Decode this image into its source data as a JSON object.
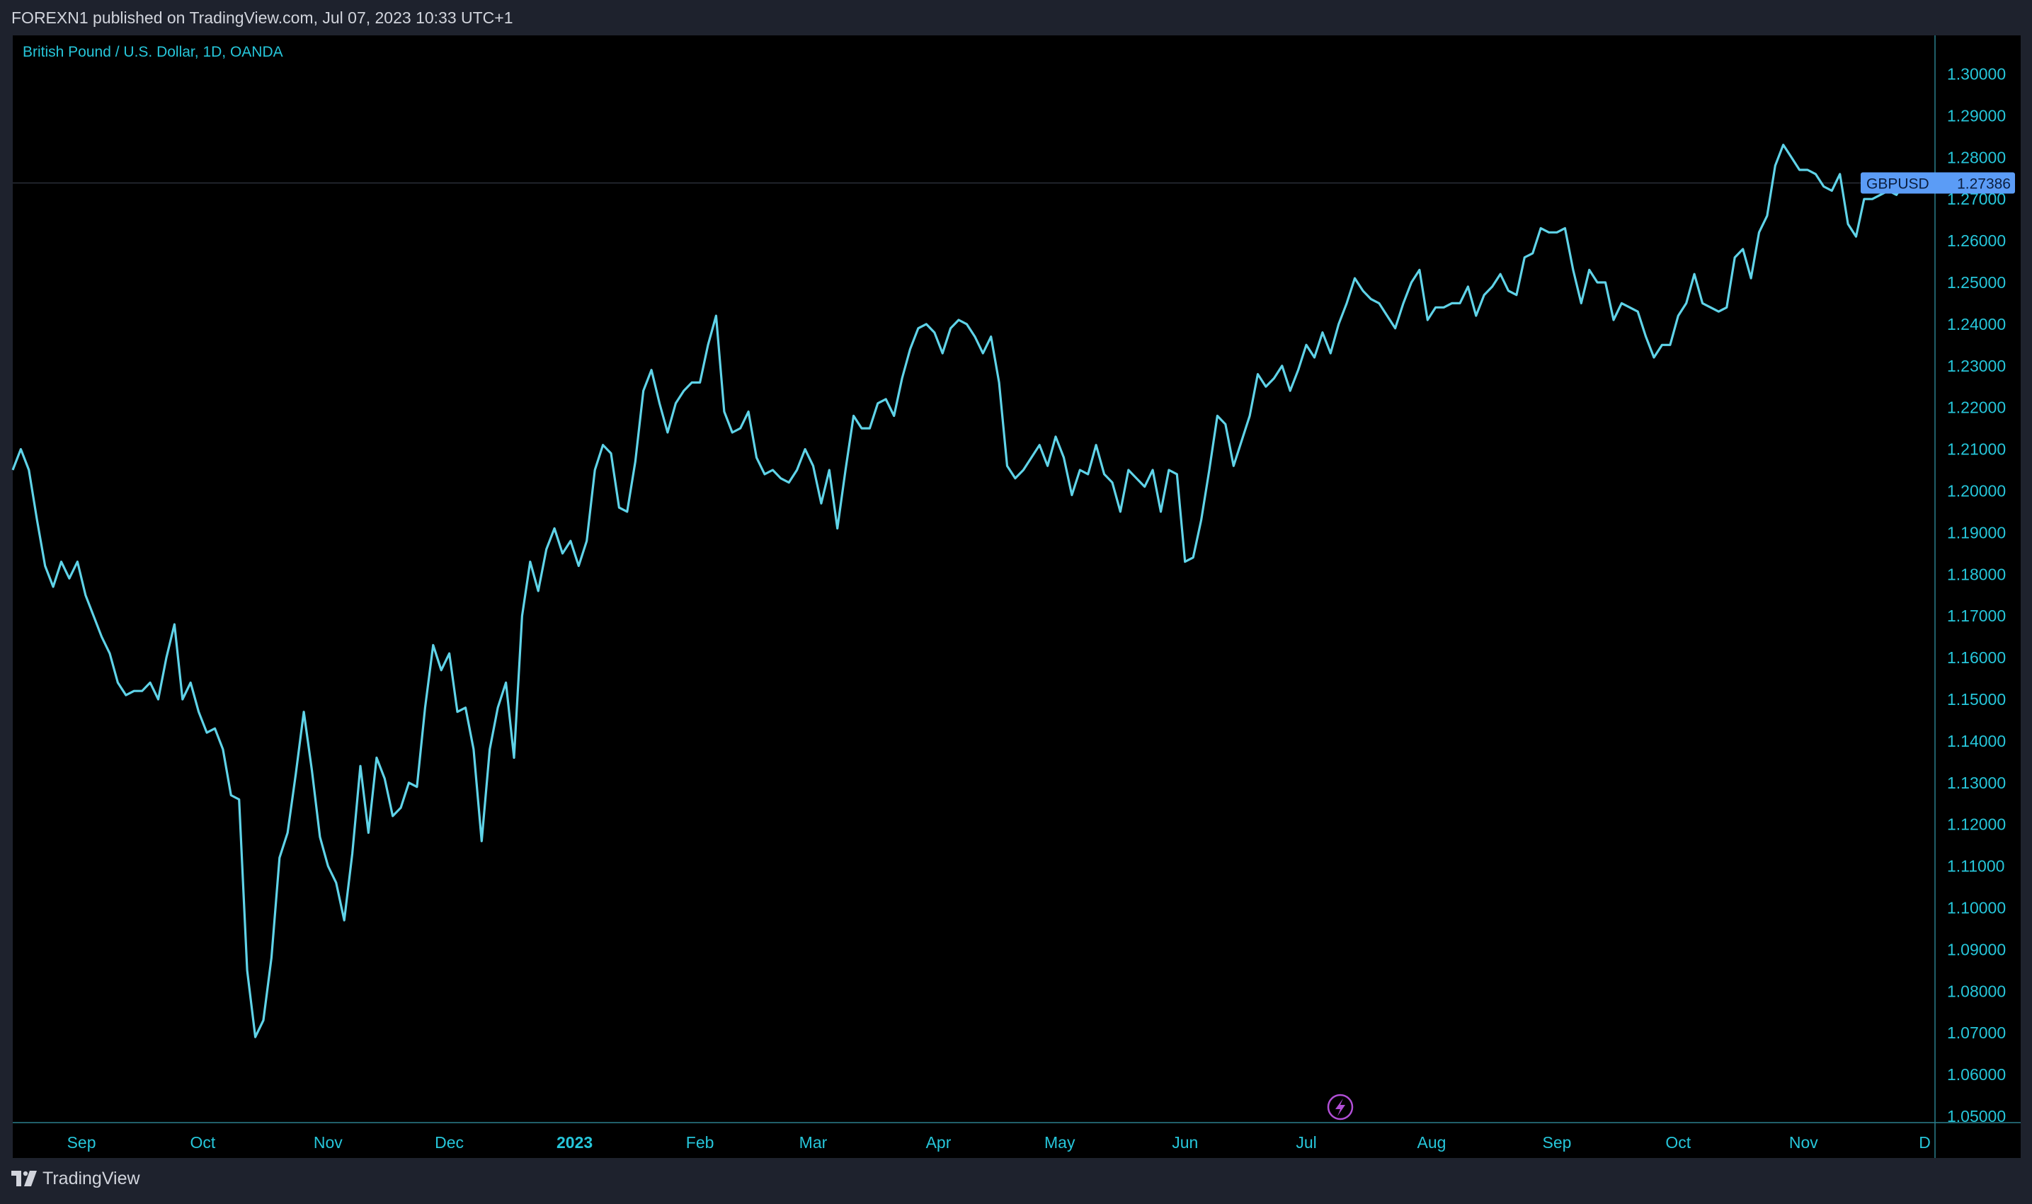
{
  "publisher": "FOREXN1 published on TradingView.com, Jul 07, 2023 10:33 UTC+1",
  "symbol_title": "British Pound / U.S. Dollar, 1D, OANDA",
  "brand": "TradingView",
  "price_badge": {
    "ticker": "GBPUSD",
    "price": "1.27386"
  },
  "colors": {
    "line": "#5fd3e8",
    "axis_text": "#26c6da",
    "badge_bg": "#5b9cf6",
    "background": "#000000"
  },
  "icons": {
    "flash": "flash-icon",
    "logo": "tradingview-logo-icon"
  },
  "chart_data": {
    "type": "line",
    "title": "British Pound / U.S. Dollar, 1D, OANDA",
    "xlabel": "",
    "ylabel": "",
    "ylim": [
      1.05,
      1.3
    ],
    "y_ticks": [
      "1.30000",
      "1.29000",
      "1.28000",
      "1.27000",
      "1.26000",
      "1.25000",
      "1.24000",
      "1.23000",
      "1.22000",
      "1.21000",
      "1.20000",
      "1.19000",
      "1.18000",
      "1.17000",
      "1.16000",
      "1.15000",
      "1.14000",
      "1.13000",
      "1.12000",
      "1.11000",
      "1.10000",
      "1.09000",
      "1.08000",
      "1.07000",
      "1.06000",
      "1.05000"
    ],
    "x_ticks": [
      {
        "label": "Sep",
        "day": 12
      },
      {
        "label": "Oct",
        "day": 42
      },
      {
        "label": "Nov",
        "day": 73
      },
      {
        "label": "Dec",
        "day": 103
      },
      {
        "label": "2023",
        "day": 134,
        "bold": true
      },
      {
        "label": "Feb",
        "day": 165
      },
      {
        "label": "Mar",
        "day": 193
      },
      {
        "label": "Apr",
        "day": 224
      },
      {
        "label": "May",
        "day": 254
      },
      {
        "label": "Jun",
        "day": 285
      },
      {
        "label": "Jul",
        "day": 315
      },
      {
        "label": "Aug",
        "day": 346
      },
      {
        "label": "Sep",
        "day": 377
      },
      {
        "label": "Oct",
        "day": 407
      },
      {
        "label": "Nov",
        "day": 438
      },
      {
        "label": "D",
        "day": 468
      }
    ],
    "x_range_days": [
      -5,
      470
    ],
    "series": [
      {
        "values": [
          [
            -5,
            1.205
          ],
          [
            -3,
            1.21
          ],
          [
            -1,
            1.205
          ],
          [
            1,
            1.193
          ],
          [
            3,
            1.182
          ],
          [
            5,
            1.177
          ],
          [
            7,
            1.183
          ],
          [
            9,
            1.179
          ],
          [
            11,
            1.183
          ],
          [
            13,
            1.175
          ],
          [
            15,
            1.17
          ],
          [
            17,
            1.165
          ],
          [
            19,
            1.161
          ],
          [
            21,
            1.154
          ],
          [
            23,
            1.151
          ],
          [
            25,
            1.152
          ],
          [
            27,
            1.152
          ],
          [
            29,
            1.154
          ],
          [
            31,
            1.15
          ],
          [
            33,
            1.16
          ],
          [
            35,
            1.168
          ],
          [
            37,
            1.15
          ],
          [
            39,
            1.154
          ],
          [
            41,
            1.147
          ],
          [
            43,
            1.142
          ],
          [
            45,
            1.143
          ],
          [
            47,
            1.138
          ],
          [
            49,
            1.127
          ],
          [
            51,
            1.126
          ],
          [
            53,
            1.085
          ],
          [
            55,
            1.069
          ],
          [
            57,
            1.073
          ],
          [
            59,
            1.088
          ],
          [
            61,
            1.112
          ],
          [
            63,
            1.118
          ],
          [
            65,
            1.132
          ],
          [
            67,
            1.147
          ],
          [
            69,
            1.133
          ],
          [
            71,
            1.117
          ],
          [
            73,
            1.11
          ],
          [
            75,
            1.106
          ],
          [
            77,
            1.097
          ],
          [
            79,
            1.113
          ],
          [
            81,
            1.134
          ],
          [
            83,
            1.118
          ],
          [
            85,
            1.136
          ],
          [
            87,
            1.131
          ],
          [
            89,
            1.122
          ],
          [
            91,
            1.124
          ],
          [
            93,
            1.13
          ],
          [
            95,
            1.129
          ],
          [
            97,
            1.148
          ],
          [
            99,
            1.163
          ],
          [
            101,
            1.157
          ],
          [
            103,
            1.161
          ],
          [
            105,
            1.147
          ],
          [
            107,
            1.148
          ],
          [
            109,
            1.138
          ],
          [
            111,
            1.116
          ],
          [
            113,
            1.138
          ],
          [
            115,
            1.148
          ],
          [
            117,
            1.154
          ],
          [
            119,
            1.136
          ],
          [
            121,
            1.17
          ],
          [
            123,
            1.183
          ],
          [
            125,
            1.176
          ],
          [
            127,
            1.186
          ],
          [
            129,
            1.191
          ],
          [
            131,
            1.185
          ],
          [
            133,
            1.188
          ],
          [
            135,
            1.182
          ],
          [
            137,
            1.188
          ],
          [
            139,
            1.205
          ],
          [
            141,
            1.211
          ],
          [
            143,
            1.209
          ],
          [
            145,
            1.196
          ],
          [
            147,
            1.195
          ],
          [
            149,
            1.207
          ],
          [
            151,
            1.224
          ],
          [
            153,
            1.229
          ],
          [
            155,
            1.221
          ],
          [
            157,
            1.214
          ],
          [
            159,
            1.221
          ],
          [
            161,
            1.224
          ],
          [
            163,
            1.226
          ],
          [
            165,
            1.226
          ],
          [
            167,
            1.235
          ],
          [
            169,
            1.242
          ],
          [
            171,
            1.219
          ],
          [
            173,
            1.214
          ],
          [
            175,
            1.215
          ],
          [
            177,
            1.219
          ],
          [
            179,
            1.208
          ],
          [
            181,
            1.204
          ],
          [
            183,
            1.205
          ],
          [
            185,
            1.203
          ],
          [
            187,
            1.202
          ],
          [
            189,
            1.205
          ],
          [
            191,
            1.21
          ],
          [
            193,
            1.206
          ],
          [
            195,
            1.197
          ],
          [
            197,
            1.205
          ],
          [
            199,
            1.191
          ],
          [
            201,
            1.205
          ],
          [
            203,
            1.218
          ],
          [
            205,
            1.215
          ],
          [
            207,
            1.215
          ],
          [
            209,
            1.221
          ],
          [
            211,
            1.222
          ],
          [
            213,
            1.218
          ],
          [
            215,
            1.227
          ],
          [
            217,
            1.234
          ],
          [
            219,
            1.239
          ],
          [
            221,
            1.24
          ],
          [
            223,
            1.238
          ],
          [
            225,
            1.233
          ],
          [
            227,
            1.239
          ],
          [
            229,
            1.241
          ],
          [
            231,
            1.24
          ],
          [
            233,
            1.237
          ],
          [
            235,
            1.233
          ],
          [
            237,
            1.237
          ],
          [
            239,
            1.226
          ],
          [
            241,
            1.206
          ],
          [
            243,
            1.203
          ],
          [
            245,
            1.205
          ],
          [
            247,
            1.208
          ],
          [
            249,
            1.211
          ],
          [
            251,
            1.206
          ],
          [
            253,
            1.213
          ],
          [
            255,
            1.208
          ],
          [
            257,
            1.199
          ],
          [
            259,
            1.205
          ],
          [
            261,
            1.204
          ],
          [
            263,
            1.211
          ],
          [
            265,
            1.204
          ],
          [
            267,
            1.202
          ],
          [
            269,
            1.195
          ],
          [
            271,
            1.205
          ],
          [
            273,
            1.203
          ],
          [
            275,
            1.201
          ],
          [
            277,
            1.205
          ],
          [
            279,
            1.195
          ],
          [
            281,
            1.205
          ],
          [
            283,
            1.204
          ],
          [
            285,
            1.183
          ],
          [
            287,
            1.184
          ],
          [
            289,
            1.193
          ],
          [
            291,
            1.205
          ],
          [
            293,
            1.218
          ],
          [
            295,
            1.216
          ],
          [
            297,
            1.206
          ],
          [
            299,
            1.212
          ],
          [
            301,
            1.218
          ],
          [
            303,
            1.228
          ],
          [
            305,
            1.225
          ],
          [
            307,
            1.227
          ],
          [
            309,
            1.23
          ],
          [
            311,
            1.224
          ],
          [
            313,
            1.229
          ],
          [
            315,
            1.235
          ],
          [
            317,
            1.232
          ],
          [
            319,
            1.238
          ],
          [
            321,
            1.233
          ],
          [
            323,
            1.24
          ],
          [
            325,
            1.245
          ],
          [
            327,
            1.251
          ],
          [
            329,
            1.248
          ],
          [
            331,
            1.246
          ],
          [
            333,
            1.245
          ],
          [
            335,
            1.242
          ],
          [
            337,
            1.239
          ],
          [
            339,
            1.245
          ],
          [
            341,
            1.25
          ],
          [
            343,
            1.253
          ],
          [
            345,
            1.241
          ],
          [
            347,
            1.244
          ],
          [
            349,
            1.244
          ],
          [
            351,
            1.245
          ],
          [
            353,
            1.245
          ],
          [
            355,
            1.249
          ],
          [
            357,
            1.242
          ],
          [
            359,
            1.247
          ],
          [
            361,
            1.249
          ],
          [
            363,
            1.252
          ],
          [
            365,
            1.248
          ],
          [
            367,
            1.247
          ],
          [
            369,
            1.256
          ],
          [
            371,
            1.257
          ],
          [
            373,
            1.263
          ],
          [
            375,
            1.262
          ],
          [
            377,
            1.262
          ],
          [
            379,
            1.263
          ],
          [
            381,
            1.253
          ],
          [
            383,
            1.245
          ],
          [
            385,
            1.253
          ],
          [
            387,
            1.25
          ],
          [
            389,
            1.25
          ],
          [
            391,
            1.241
          ],
          [
            393,
            1.245
          ],
          [
            395,
            1.244
          ],
          [
            397,
            1.243
          ],
          [
            399,
            1.237
          ],
          [
            401,
            1.232
          ],
          [
            403,
            1.235
          ],
          [
            405,
            1.235
          ],
          [
            407,
            1.242
          ],
          [
            409,
            1.245
          ],
          [
            411,
            1.252
          ],
          [
            413,
            1.245
          ],
          [
            415,
            1.244
          ],
          [
            417,
            1.243
          ],
          [
            419,
            1.244
          ],
          [
            421,
            1.256
          ],
          [
            423,
            1.258
          ],
          [
            425,
            1.251
          ],
          [
            427,
            1.262
          ],
          [
            429,
            1.266
          ],
          [
            431,
            1.278
          ],
          [
            433,
            1.283
          ],
          [
            435,
            1.28
          ],
          [
            437,
            1.277
          ],
          [
            439,
            1.277
          ],
          [
            441,
            1.276
          ],
          [
            443,
            1.273
          ],
          [
            445,
            1.272
          ],
          [
            447,
            1.276
          ],
          [
            449,
            1.264
          ],
          [
            451,
            1.261
          ],
          [
            453,
            1.27
          ],
          [
            455,
            1.27
          ],
          [
            457,
            1.271
          ],
          [
            459,
            1.272
          ],
          [
            461,
            1.271
          ],
          [
            463,
            1.274
          ],
          [
            465,
            1.274
          ]
        ]
      }
    ],
    "last_value": 1.27386,
    "grid": false,
    "legend": "none"
  }
}
